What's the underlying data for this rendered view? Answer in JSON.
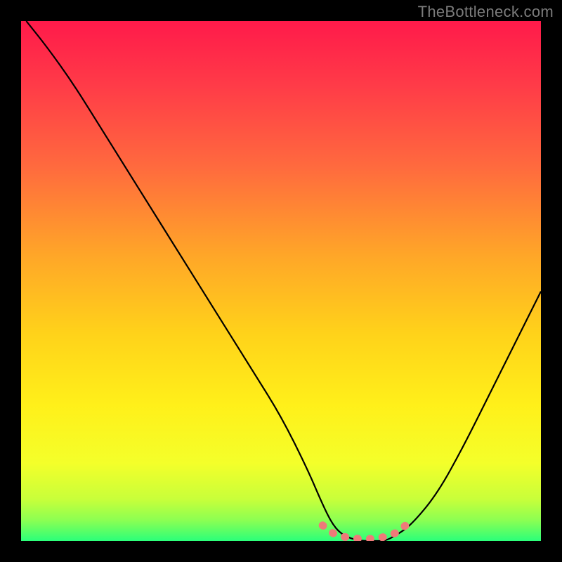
{
  "watermark": "TheBottleneck.com",
  "gradient": {
    "stops": [
      {
        "offset": "0%",
        "color": "#ff1a4a"
      },
      {
        "offset": "12%",
        "color": "#ff3a48"
      },
      {
        "offset": "28%",
        "color": "#ff6a3e"
      },
      {
        "offset": "45%",
        "color": "#ffa628"
      },
      {
        "offset": "60%",
        "color": "#ffd21a"
      },
      {
        "offset": "74%",
        "color": "#fff01a"
      },
      {
        "offset": "85%",
        "color": "#f4ff2a"
      },
      {
        "offset": "92%",
        "color": "#c8ff3a"
      },
      {
        "offset": "96%",
        "color": "#8cff52"
      },
      {
        "offset": "100%",
        "color": "#2bff7a"
      }
    ]
  },
  "chart_data": {
    "type": "line",
    "title": "",
    "xlabel": "",
    "ylabel": "",
    "xlim": [
      0,
      100
    ],
    "ylim": [
      0,
      100
    ],
    "series": [
      {
        "name": "bottleneck-curve",
        "x": [
          1,
          5,
          10,
          15,
          20,
          25,
          30,
          35,
          40,
          45,
          50,
          55,
          58,
          60,
          62,
          65,
          68,
          70,
          72,
          75,
          80,
          85,
          90,
          95,
          100
        ],
        "y": [
          100,
          95,
          88,
          80,
          72,
          64,
          56,
          48,
          40,
          32,
          24,
          14,
          7,
          3,
          1,
          0,
          0,
          0,
          1,
          3,
          9,
          18,
          28,
          38,
          48
        ]
      },
      {
        "name": "optimal-band",
        "x": [
          58,
          60,
          62,
          65,
          68,
          70,
          72,
          74
        ],
        "y": [
          3,
          1.5,
          0.8,
          0.4,
          0.4,
          0.8,
          1.5,
          3
        ]
      }
    ]
  }
}
